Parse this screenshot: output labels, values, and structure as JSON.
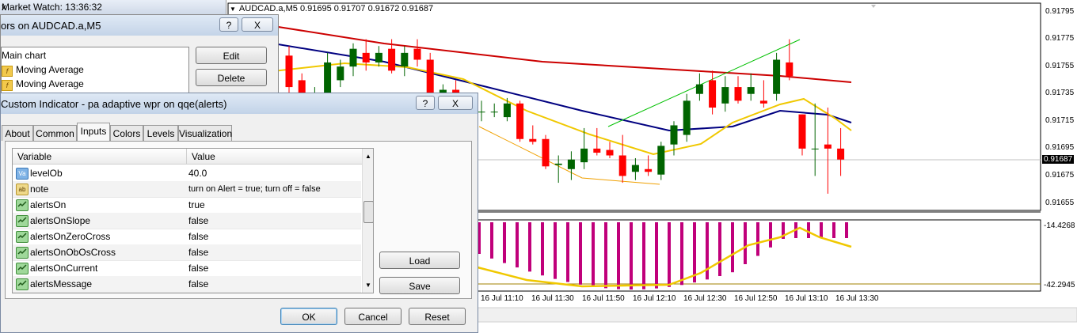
{
  "market_watch": {
    "title": "Market Watch: 13:36:32",
    "close": "x"
  },
  "indicators_dialog": {
    "title": "ors on AUDCAD.a,M5",
    "help_btn": "?",
    "close_btn": "X",
    "tree_root": "Main chart",
    "items": [
      "Moving Average",
      "Moving Average"
    ],
    "edit_btn": "Edit",
    "delete_btn": "Delete"
  },
  "custom_indicator": {
    "title": "Custom Indicator - pa adaptive wpr on qqe(alerts)",
    "help_btn": "?",
    "close_btn": "X",
    "tabs": [
      "About",
      "Common",
      "Inputs",
      "Colors",
      "Levels",
      "Visualization"
    ],
    "active_tab": "Inputs",
    "grid": {
      "col_variable": "Variable",
      "col_value": "Value",
      "rows": [
        {
          "icon": "numeric-icon",
          "icon_text": "Va",
          "name": "levelOb",
          "value": "40.0"
        },
        {
          "icon": "string-icon",
          "icon_text": "ab",
          "name": "note",
          "value": "turn on Alert = true; turn off = false"
        },
        {
          "icon": "bool-icon",
          "icon_text": "",
          "name": "alertsOn",
          "value": "true"
        },
        {
          "icon": "bool-icon",
          "icon_text": "",
          "name": "alertsOnSlope",
          "value": "false"
        },
        {
          "icon": "bool-icon",
          "icon_text": "",
          "name": "alertsOnZeroCross",
          "value": "false"
        },
        {
          "icon": "bool-icon",
          "icon_text": "",
          "name": "alertsOnObOsCross",
          "value": "false"
        },
        {
          "icon": "bool-icon",
          "icon_text": "",
          "name": "alertsOnCurrent",
          "value": "false"
        },
        {
          "icon": "bool-icon",
          "icon_text": "",
          "name": "alertsMessage",
          "value": "false"
        }
      ]
    },
    "load_btn": "Load",
    "save_btn": "Save",
    "ok_btn": "OK",
    "cancel_btn": "Cancel",
    "reset_btn": "Reset"
  },
  "chart": {
    "header": "AUDCAD.a,M5  0.91695 0.91707 0.91672 0.91687",
    "price_labels": [
      "0.91795",
      "0.91775",
      "0.91755",
      "0.91735",
      "0.91715",
      "0.91695",
      "0.91675",
      "0.91655"
    ],
    "current_price": "0.91687",
    "indicator_labels": [
      "-14.4268",
      "-42.2945"
    ],
    "time_labels": [
      "16 Jul 11:10",
      "16 Jul 11:30",
      "16 Jul 11:50",
      "16 Jul 12:10",
      "16 Jul 12:30",
      "16 Jul 12:50",
      "16 Jul 13:10",
      "16 Jul 13:30"
    ],
    "colors": {
      "bull": "#006400",
      "bear": "#ff0000",
      "ma_slow": "#cc0000",
      "ma_mid": "#000080",
      "ma_fast": "#f0c800",
      "hist": "#c0007a",
      "signal": "#f0c800",
      "trend_up": "#00c000",
      "trend_lo": "#f0a000"
    }
  },
  "chart_data": {
    "type": "candlestick",
    "symbol": "AUDCAD.a",
    "timeframe": "M5",
    "ylim": [
      0.9165,
      0.918
    ],
    "ohlc": [
      [
        0.91763,
        0.9177,
        0.9173,
        0.9174
      ],
      [
        0.91745,
        0.9175,
        0.91725,
        0.91735
      ],
      [
        0.91732,
        0.9174,
        0.91728,
        0.91733
      ],
      [
        0.91735,
        0.91765,
        0.91732,
        0.91758
      ],
      [
        0.91745,
        0.9176,
        0.9174,
        0.91755
      ],
      [
        0.91755,
        0.91772,
        0.91748,
        0.91768
      ],
      [
        0.91765,
        0.91775,
        0.91752,
        0.91758
      ],
      [
        0.91758,
        0.9177,
        0.91755,
        0.91765
      ],
      [
        0.91768,
        0.91775,
        0.9175,
        0.91752
      ],
      [
        0.91755,
        0.9177,
        0.91748,
        0.91765
      ],
      [
        0.91768,
        0.91775,
        0.91755,
        0.9176
      ],
      [
        0.9176,
        0.91765,
        0.9173,
        0.91735
      ],
      [
        0.91735,
        0.91742,
        0.91728,
        0.91738
      ],
      [
        0.91738,
        0.91745,
        0.91725,
        0.9173
      ],
      [
        0.91728,
        0.91735,
        0.91715,
        0.9172
      ],
      [
        0.91722,
        0.9173,
        0.91715,
        0.91722
      ],
      [
        0.91722,
        0.91728,
        0.91718,
        0.91722
      ],
      [
        0.91718,
        0.91732,
        0.91715,
        0.91728
      ],
      [
        0.91728,
        0.9173,
        0.917,
        0.91702
      ],
      [
        0.91702,
        0.91712,
        0.91698,
        0.917
      ],
      [
        0.91702,
        0.91705,
        0.9168,
        0.91682
      ],
      [
        0.91683,
        0.9169,
        0.9167,
        0.91684
      ],
      [
        0.9168,
        0.91693,
        0.91672,
        0.91687
      ],
      [
        0.91685,
        0.9171,
        0.9168,
        0.91695
      ],
      [
        0.91695,
        0.9171,
        0.9169,
        0.91692
      ],
      [
        0.91694,
        0.917,
        0.91688,
        0.9169
      ],
      [
        0.9169,
        0.91705,
        0.9167,
        0.91675
      ],
      [
        0.91678,
        0.91688,
        0.91672,
        0.91683
      ],
      [
        0.9168,
        0.9169,
        0.91675,
        0.91678
      ],
      [
        0.91676,
        0.917,
        0.91672,
        0.91697
      ],
      [
        0.91698,
        0.91715,
        0.9169,
        0.91712
      ],
      [
        0.91705,
        0.91735,
        0.917,
        0.9173
      ],
      [
        0.91735,
        0.9175,
        0.9173,
        0.91742
      ],
      [
        0.91745,
        0.91752,
        0.9172,
        0.91725
      ],
      [
        0.91728,
        0.91748,
        0.91722,
        0.9174
      ],
      [
        0.9174,
        0.91748,
        0.91728,
        0.9173
      ],
      [
        0.91735,
        0.9175,
        0.9173,
        0.9174
      ],
      [
        0.9173,
        0.91745,
        0.91725,
        0.91728
      ],
      [
        0.91735,
        0.91765,
        0.9173,
        0.9176
      ],
      [
        0.91758,
        0.91775,
        0.91745,
        0.91748
      ],
      [
        0.9172,
        0.9172,
        0.9169,
        0.91695
      ],
      [
        0.91695,
        0.91728,
        0.91675,
        0.91695
      ],
      [
        0.91698,
        0.91725,
        0.91662,
        0.91695
      ],
      [
        0.91695,
        0.9171,
        0.91675,
        0.91687
      ]
    ]
  }
}
